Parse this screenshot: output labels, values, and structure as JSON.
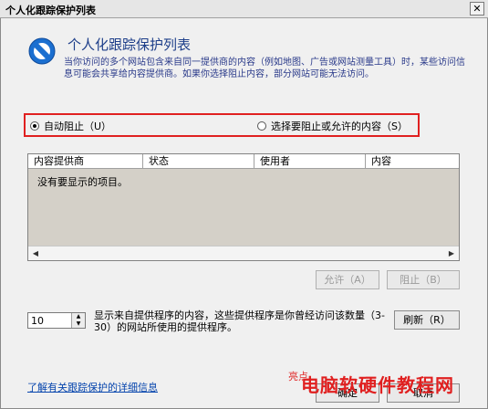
{
  "window": {
    "title": "个人化跟踪保护列表",
    "close_glyph": "✕"
  },
  "header": {
    "title": "个人化跟踪保护列表",
    "description": "当你访问的多个网站包含来自同一提供商的内容（例如地图、广告或网站测量工具）时，某些访问信息可能会共享给内容提供商。如果你选择阻止内容，部分网站可能无法访问。"
  },
  "options": {
    "auto_block": "自动阻止（U）",
    "choose": "选择要阻止或允许的内容（S）",
    "selected": "auto_block"
  },
  "table": {
    "columns": [
      "内容提供商",
      "状态",
      "使用者",
      "内容"
    ],
    "empty_message": "没有要显示的项目。"
  },
  "buttons": {
    "allow": "允许（A）",
    "block": "阻止（B）",
    "refresh": "刷新（R）",
    "ok": "确定",
    "cancel": "取消"
  },
  "threshold": {
    "value": "10",
    "text": "显示来自提供程序的内容，这些提供程序是你曾经访问该数量（3-30）的网站所使用的提供程序。"
  },
  "footer": {
    "link": "了解有关跟踪保护的详细信息",
    "watermark_small": "亮点",
    "watermark_big": "电脑软硬件教程网"
  },
  "icons": {
    "main": "no-entry-icon"
  },
  "colors": {
    "header_text": "#1e3f8a",
    "highlight_border": "#e02020",
    "link": "#0645ad"
  }
}
